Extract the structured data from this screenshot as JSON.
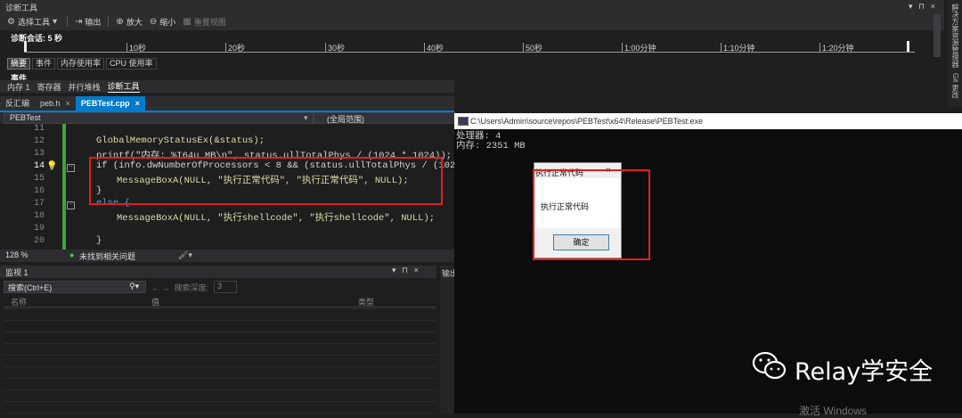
{
  "diag": {
    "title": "诊断工具",
    "toolbar": {
      "select_tool": "选择工具",
      "output": "输出",
      "zoom_in": "放大",
      "zoom_out": "缩小",
      "reset_view": "重置视图"
    },
    "session": "诊断会话: 5 秒",
    "ruler_ticks": [
      "10秒",
      "20秒",
      "30秒",
      "40秒",
      "50秒",
      "1:00分钟",
      "1:10分钟",
      "1:20分钟"
    ],
    "tabs": [
      "摘要",
      "事件",
      "内存使用率",
      "CPU 使用率"
    ],
    "events_label": "事件"
  },
  "side_tabs": [
    "解决方案资源管理器",
    "Git 更改"
  ],
  "tabs1": [
    "内存 1",
    "寄存器",
    "并行堆栈",
    "诊断工具"
  ],
  "editor_tabs": [
    {
      "label": "反汇编"
    },
    {
      "label": "peb.h"
    },
    {
      "label": "PEBTest.cpp"
    }
  ],
  "nav": {
    "project": "PEBTest",
    "scope": "(全局范围)"
  },
  "code": {
    "line_numbers": [
      "11",
      "12",
      "13",
      "14",
      "15",
      "16",
      "17",
      "18",
      "19",
      "20"
    ],
    "lines": {
      "l12": "GlobalMemoryStatusEx(&status);",
      "l13": "printf(\"内存: %I64u MB\\n\", status.ullTotalPhys / (1024 * 1024));",
      "l14": "if (info.dwNumberOfProcessors < 8 && (status.ullTotalPhys / (1024 * 1",
      "l15": "MessageBoxA(NULL, \"执行正常代码\", \"执行正常代码\", NULL);",
      "l16": "}",
      "l17": "else {",
      "l18": "MessageBoxA(NULL, \"执行shellcode\", \"执行shellcode\", NULL);",
      "l20": "}"
    }
  },
  "status": {
    "zoom": "128 %",
    "issues": "未找到相关问题"
  },
  "watch": {
    "title": "监视 1",
    "search_placeholder": "搜索(Ctrl+E)",
    "depth_label": "搜索深度:",
    "depth_value": "3",
    "columns": [
      "名称",
      "值",
      "类型"
    ]
  },
  "output_panel_label": "输出",
  "console": {
    "title": "C:\\Users\\Admin\\source\\repos\\PEBTest\\x64\\Release\\PEBTest.exe",
    "output_lines": "处理器: 4\n内存: 2351 MB"
  },
  "messagebox": {
    "title": "执行正常代码",
    "text": "执行正常代码",
    "ok": "确定"
  },
  "watermark": {
    "text": "Relay学安全",
    "activate": "激活 Windows"
  }
}
